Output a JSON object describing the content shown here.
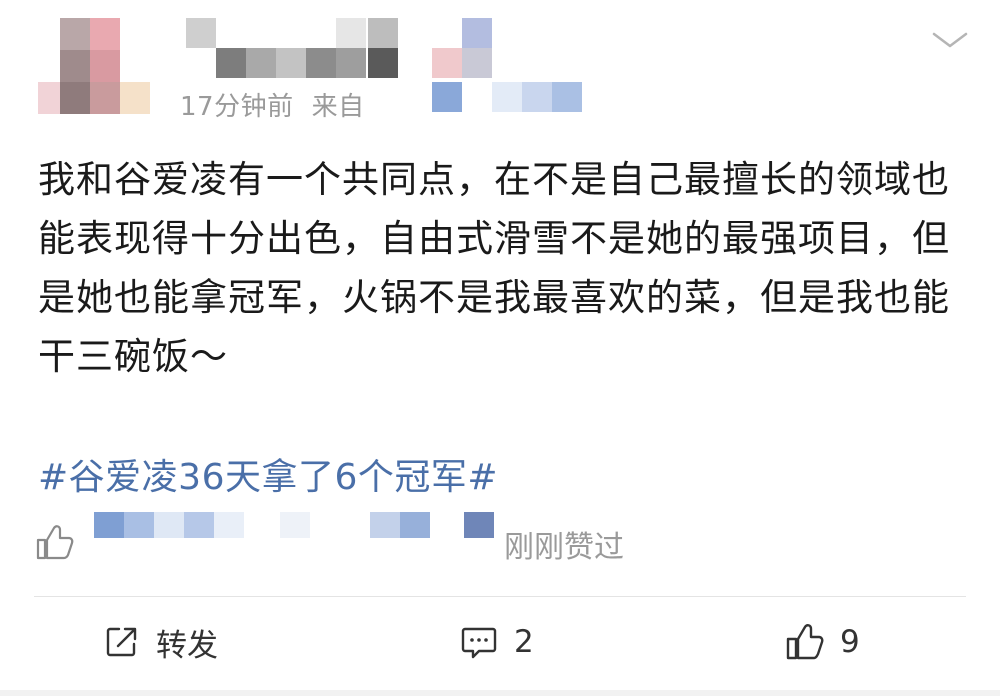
{
  "post": {
    "time": "17分钟前",
    "source_prefix": "来自",
    "body": "我和谷爱凌有一个共同点，在不是自己最擅长的领域也能表现得十分出色，自由式滑雪不是她的最强项目，但是她也能拿冠军，火锅不是我最喜欢的菜，但是我也能干三碗饭～",
    "hashtag": "#谷爱凌36天拿了6个冠军#",
    "liked_status": "刚刚赞过"
  },
  "actions": {
    "repost_label": "转发",
    "comment_count": "2",
    "like_count": "9"
  },
  "icons": {
    "menu": "chevron-down-icon",
    "thumb": "thumbs-up-icon",
    "repost": "share-icon",
    "comment": "comment-icon"
  },
  "colors": {
    "hashtag": "#4a6fa8",
    "meta": "#9a9a9a",
    "body": "#1a1a1a"
  }
}
